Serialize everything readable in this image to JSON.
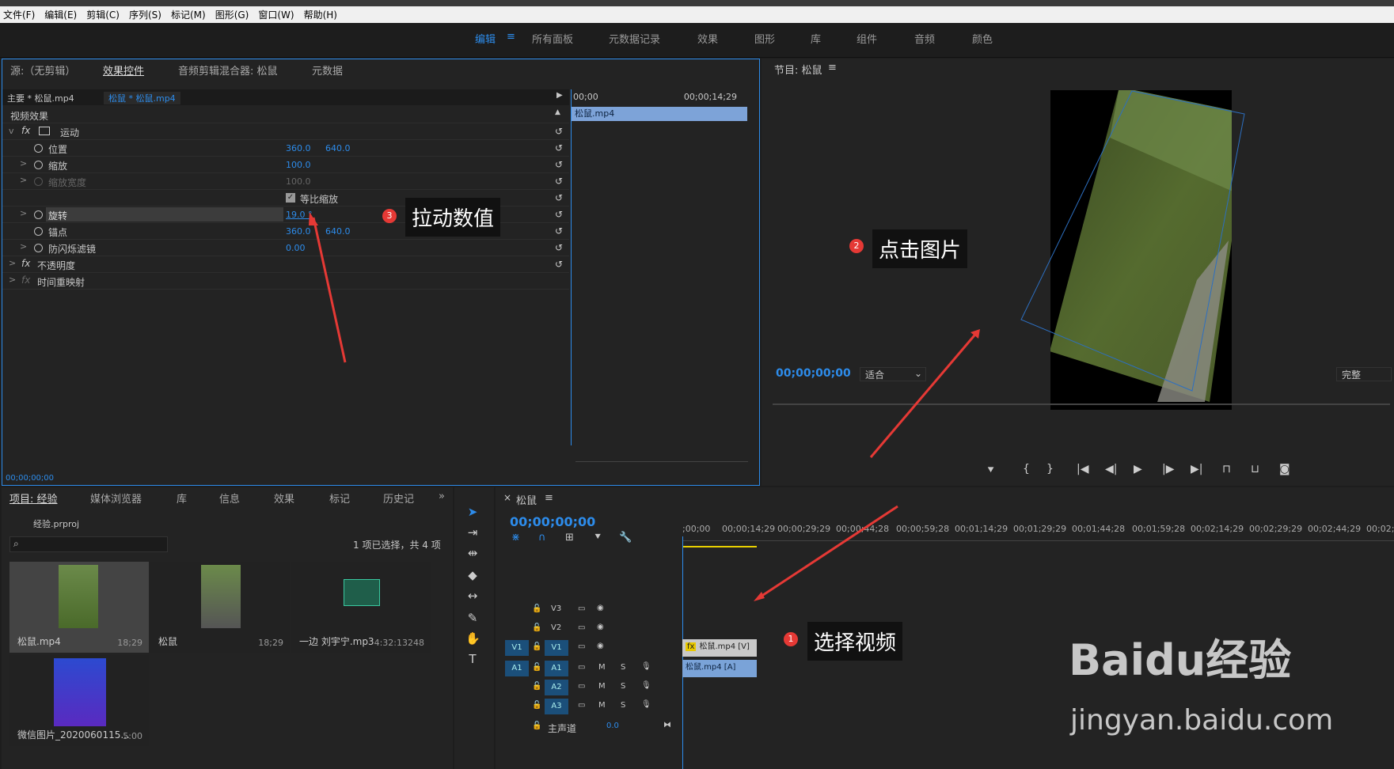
{
  "menu": [
    "文件(F)",
    "编辑(E)",
    "剪辑(C)",
    "序列(S)",
    "标记(M)",
    "图形(G)",
    "窗口(W)",
    "帮助(H)"
  ],
  "workspaces": {
    "active": "编辑",
    "items": [
      "所有面板",
      "元数据记录",
      "效果",
      "图形",
      "库",
      "组件",
      "音频",
      "颜色"
    ]
  },
  "source_panel": {
    "tabs": [
      "源:（无剪辑）",
      "效果控件",
      "音频剪辑混合器: 松鼠",
      "元数据"
    ],
    "master": "主要 * 松鼠.mp4",
    "clip": "松鼠 * 松鼠.mp4",
    "tc_start": "00;00",
    "tc_end": "00;00;14;29",
    "clip_bar": "松鼠.mp4",
    "section": "视频效果",
    "motion": "运动",
    "props": {
      "position": {
        "label": "位置",
        "v1": "360.0",
        "v2": "640.0"
      },
      "scale": {
        "label": "缩放",
        "v1": "100.0"
      },
      "scale_width": {
        "label": "缩放宽度",
        "v1": "100.0"
      },
      "uniform": "等比缩放",
      "rotation": {
        "label": "旋转",
        "v1": "19.0 °"
      },
      "anchor": {
        "label": "锚点",
        "v1": "360.0",
        "v2": "640.0"
      },
      "flicker": {
        "label": "防闪烁滤镜",
        "v1": "0.00"
      }
    },
    "opacity": "不透明度",
    "time_remap": "时间重映射",
    "footer_tc": "00;00;00;00"
  },
  "program_panel": {
    "title": "节目: 松鼠",
    "timecode": "00;00;00;00",
    "fit": "适合",
    "quality": "完整"
  },
  "project_panel": {
    "tabs": [
      "项目: 经验",
      "媒体浏览器",
      "库",
      "信息",
      "效果",
      "标记",
      "历史记"
    ],
    "file": "经验.prproj",
    "selection": "1 项已选择，共 4 项",
    "items": [
      {
        "name": "松鼠.mp4",
        "dur": "18;29"
      },
      {
        "name": "松鼠",
        "dur": "18;29"
      },
      {
        "name": "一边 刘宇宁.mp3",
        "dur": "4:32:13248"
      },
      {
        "name": "微信图片_2020060115...",
        "dur": "5:00"
      }
    ]
  },
  "timeline": {
    "title": "松鼠",
    "timecode": "00;00;00;00",
    "ruler": [
      ";00;00",
      "00;00;14;29",
      "00;00;29;29",
      "00;00;44;28",
      "00;00;59;28",
      "00;01;14;29",
      "00;01;29;29",
      "00;01;44;28",
      "00;01;59;28",
      "00;02;14;29",
      "00;02;29;29",
      "00;02;44;29",
      "00;02;59;2"
    ],
    "tracks_v": [
      "V3",
      "V2",
      "V1"
    ],
    "tracks_a": [
      "A1",
      "A2",
      "A3"
    ],
    "master": "主声道",
    "master_val": "0.0",
    "clip_v": "松鼠.mp4 [V]",
    "clip_a": "松鼠.mp4 [A]",
    "track_btn_m": "M",
    "track_btn_s": "S"
  },
  "annotations": [
    {
      "num": "1",
      "text": "选择视频"
    },
    {
      "num": "2",
      "text": "点击图片"
    },
    {
      "num": "3",
      "text": "拉动数值"
    }
  ],
  "watermark": {
    "brand": "Baidu经验",
    "url": "jingyan.baidu.com"
  }
}
